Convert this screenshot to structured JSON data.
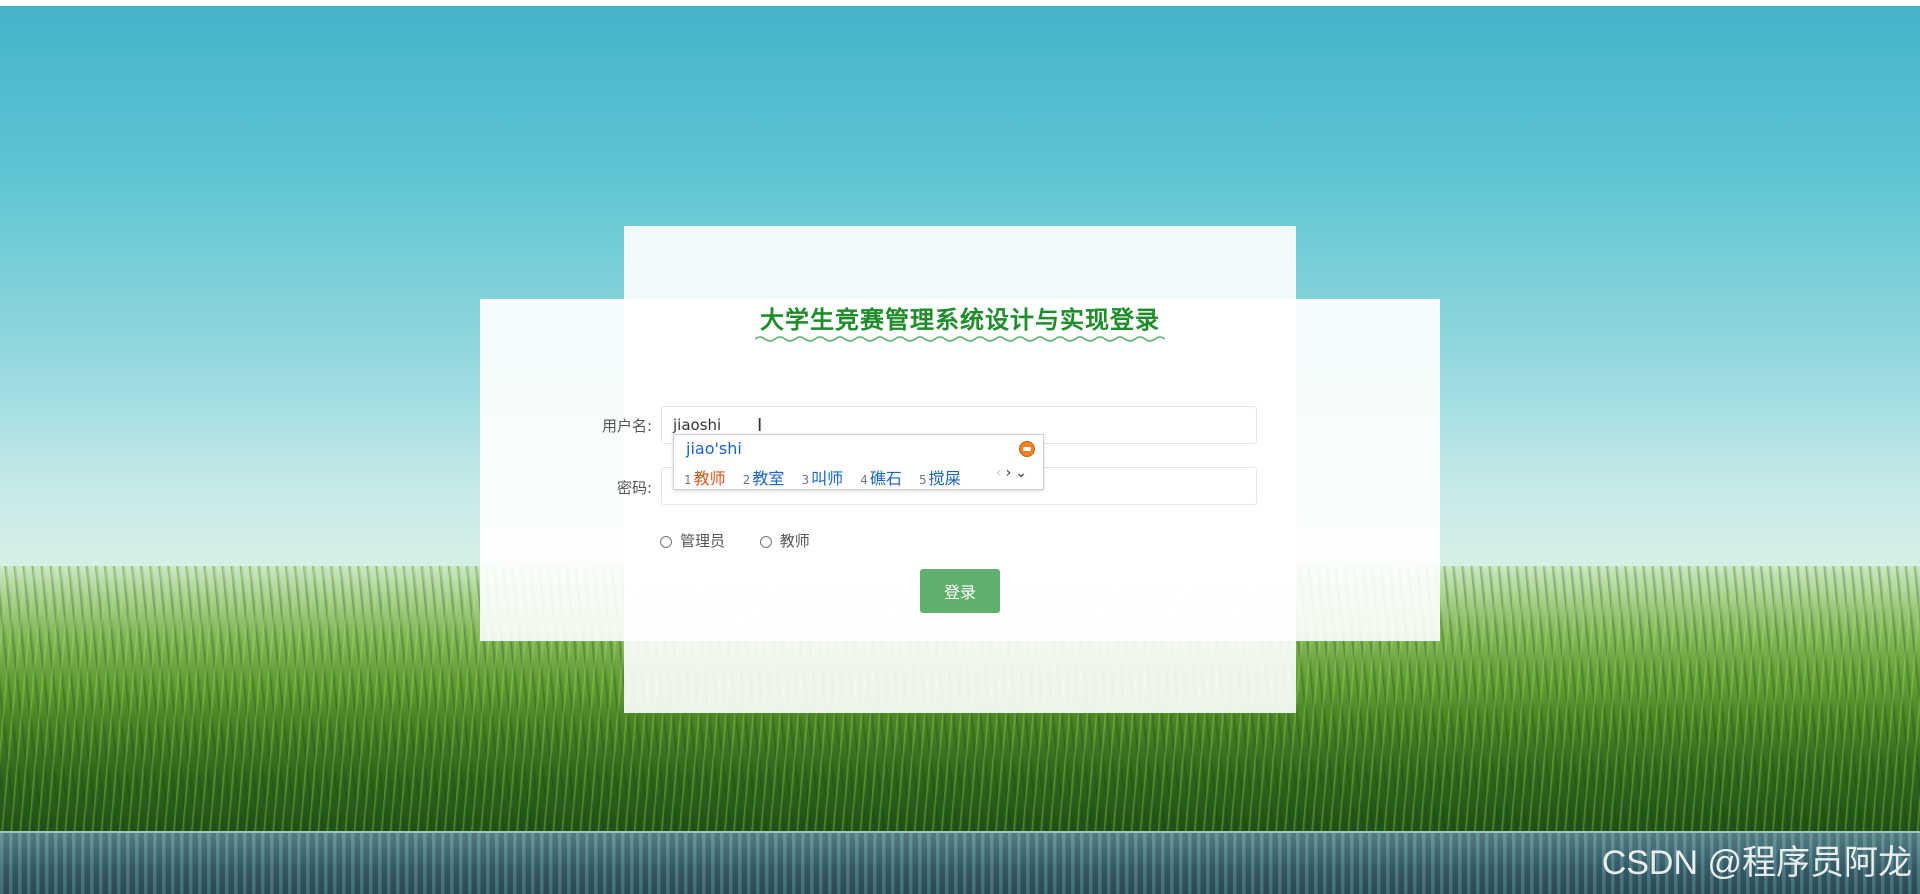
{
  "title": "大学生竞赛管理系统设计与实现登录",
  "form": {
    "username_label": "用户名:",
    "username_value": "jiaoshi",
    "password_label": "密码:",
    "roles": [
      "管理员",
      "教师"
    ],
    "login_label": "登录"
  },
  "ime": {
    "composition": "jiao'shi",
    "candidates": [
      {
        "num": "1",
        "text": "教师"
      },
      {
        "num": "2",
        "text": "教室"
      },
      {
        "num": "3",
        "text": "叫师"
      },
      {
        "num": "4",
        "text": "礁石"
      },
      {
        "num": "5",
        "text": "搅屎"
      }
    ],
    "prev": "‹",
    "next": "›",
    "expand": "⌄"
  },
  "watermark": "CSDN @程序员阿龙",
  "colors": {
    "title": "#1f8c2a",
    "button": "#5fb06c",
    "ime_active": "#e0531b",
    "ime_text": "#1a64c5"
  }
}
